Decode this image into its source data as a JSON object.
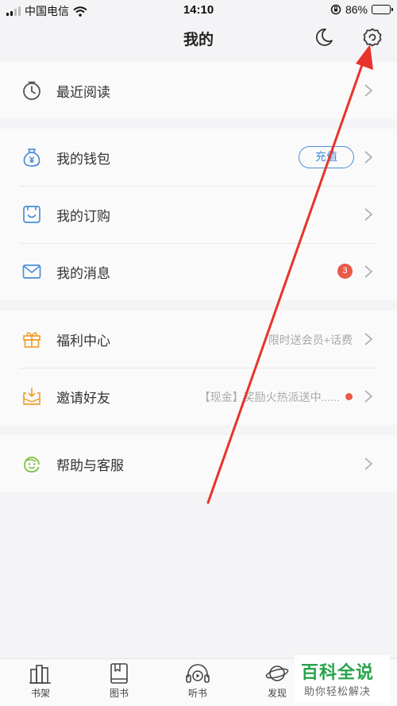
{
  "status_bar": {
    "carrier": "中国电信",
    "time": "14:10",
    "battery_percent": "86%",
    "battery_level": 0.86
  },
  "header": {
    "title": "我的"
  },
  "groups": [
    {
      "items": [
        {
          "label": "最近阅读",
          "icon": "clock-icon"
        }
      ]
    },
    {
      "items": [
        {
          "label": "我的钱包",
          "icon": "wallet-icon",
          "action": "充值"
        },
        {
          "label": "我的订购",
          "icon": "subscription-icon"
        },
        {
          "label": "我的消息",
          "icon": "mail-icon",
          "badge": "3"
        }
      ]
    },
    {
      "items": [
        {
          "label": "福利中心",
          "icon": "gift-icon",
          "subtitle": "限时送会员+话费"
        },
        {
          "label": "邀请好友",
          "icon": "invite-icon",
          "subtitle": "【现金】奖励火热派送中......"
        }
      ]
    },
    {
      "items": [
        {
          "label": "帮助与客服",
          "icon": "help-icon"
        }
      ]
    }
  ],
  "tabbar": [
    {
      "label": "书架",
      "icon": "bookshelf-icon"
    },
    {
      "label": "图书",
      "icon": "book-icon"
    },
    {
      "label": "听书",
      "icon": "headphones-icon"
    },
    {
      "label": "发现",
      "icon": "planet-icon"
    }
  ],
  "watermark": {
    "title": "百科全说",
    "subtitle": "助你轻松解决"
  },
  "colors": {
    "accent_blue": "#4a8ed8",
    "accent_orange": "#f0a030",
    "badge_red": "#ea5a4a",
    "help_green": "#7cbf3a",
    "arrow_red": "#e8332a"
  }
}
